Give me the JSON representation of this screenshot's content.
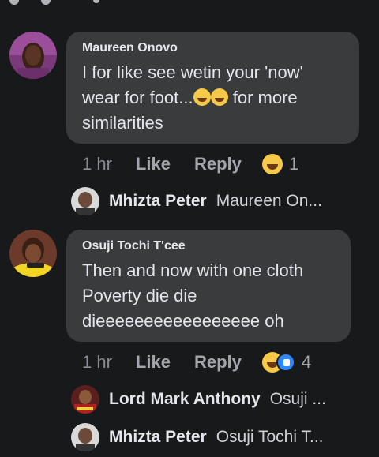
{
  "comments": [
    {
      "author": "Maureen Onovo",
      "text_before_emoji": "I for like see wetin your 'now' wear for foot...",
      "text_after_emoji": " for more similarities",
      "time": "1 hr",
      "like_label": "Like",
      "reply_label": "Reply",
      "reaction_count": "1",
      "reactions": [
        "haha-icon"
      ]
    },
    {
      "author": "Osuji Tochi T'cee",
      "text": "Then and now with one cloth Poverty die die dieeeeeeeeeeeeeeeee oh",
      "time": "1 hr",
      "like_label": "Like",
      "reply_label": "Reply",
      "reaction_count": "4",
      "reactions": [
        "haha-icon",
        "like-icon"
      ]
    }
  ],
  "replies": [
    {
      "name": "Mhizta Peter",
      "preview": "Maureen On..."
    },
    {
      "name": "Lord Mark Anthony",
      "preview": "Osuji ..."
    },
    {
      "name": "Mhizta Peter",
      "preview": "Osuji Tochi T..."
    }
  ],
  "colors": {
    "background": "#18191a",
    "bubble": "#3a3b3c",
    "text": "#e4e6eb",
    "muted": "#8a8d91",
    "haha": "#f7c948",
    "like": "#2d88ff"
  }
}
